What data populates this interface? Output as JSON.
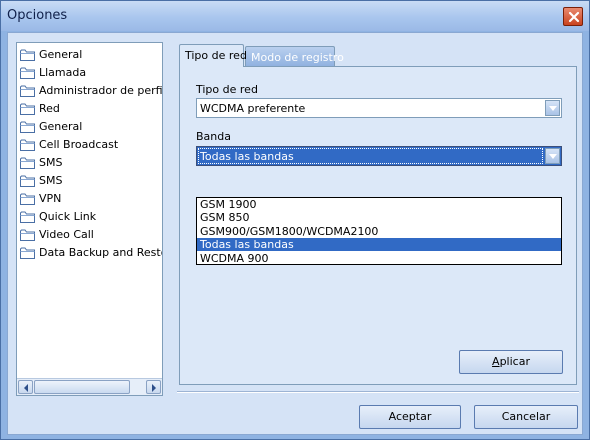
{
  "window": {
    "title": "Opciones",
    "close_glyph": "×"
  },
  "tree": {
    "items": [
      {
        "label": "General",
        "icon": "folder-icon"
      },
      {
        "label": "Llamada",
        "icon": "folder-icon"
      },
      {
        "label": "Administrador de perfiles",
        "icon": "folder-icon"
      },
      {
        "label": "Red",
        "icon": "folder-icon"
      },
      {
        "label": "General",
        "icon": "folder-icon"
      },
      {
        "label": "Cell Broadcast",
        "icon": "folder-icon"
      },
      {
        "label": "SMS",
        "icon": "folder-icon"
      },
      {
        "label": "SMS",
        "icon": "folder-icon"
      },
      {
        "label": "VPN",
        "icon": "folder-icon"
      },
      {
        "label": "Quick Link",
        "icon": "folder-icon"
      },
      {
        "label": "Video Call",
        "icon": "folder-icon"
      },
      {
        "label": "Data Backup and Restora",
        "icon": "folder-icon"
      }
    ]
  },
  "tabs": {
    "active": "Tipo de red",
    "inactive": "Modo de registro"
  },
  "form": {
    "network_type_label": "Tipo de red",
    "network_type_value": "WCDMA preferente",
    "band_label": "Banda",
    "band_value": "Todas las bandas",
    "band_options": [
      "GSM 1900",
      "GSM 850",
      "GSM900/GSM1800/WCDMA2100",
      "Todas las bandas",
      "WCDMA 900"
    ],
    "band_selected_index": 3
  },
  "buttons": {
    "apply_first": "A",
    "apply_rest": "plicar",
    "ok": "Aceptar",
    "cancel": "Cancelar"
  },
  "colors": {
    "selection": "#316ac5",
    "window_frame": "#8fb3e2",
    "panel_bg": "#dce8f8"
  }
}
